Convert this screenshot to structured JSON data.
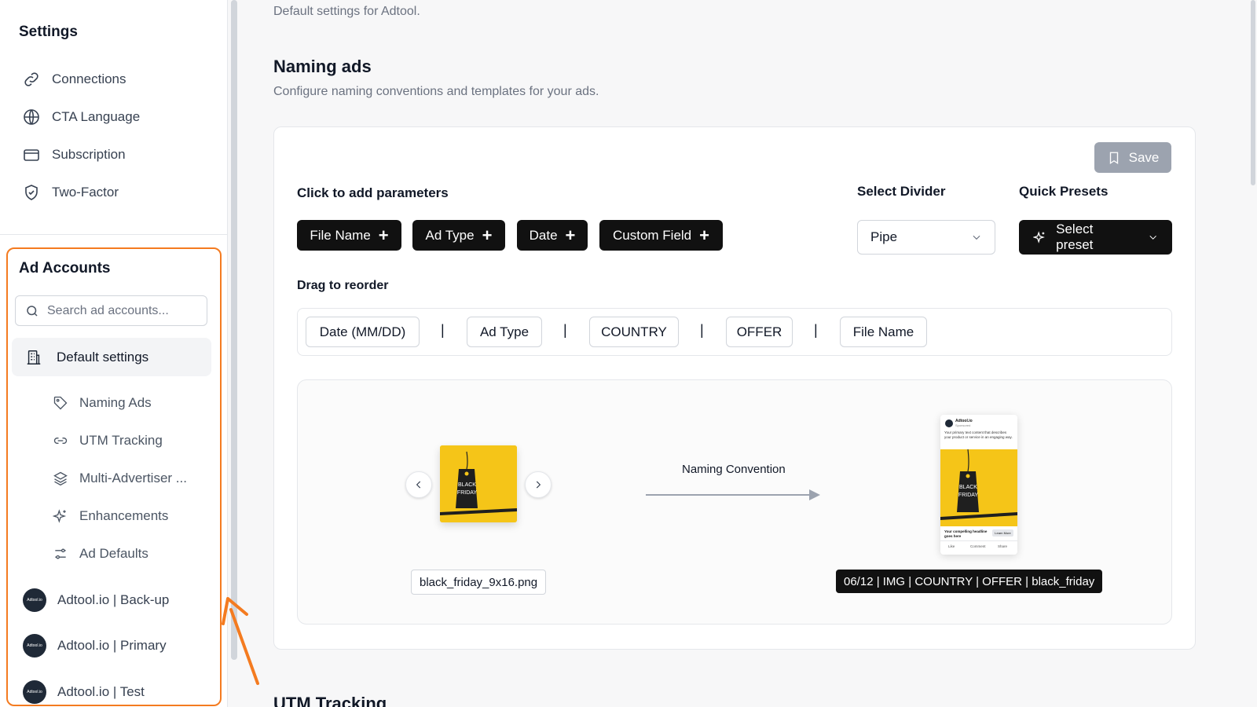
{
  "sidebar": {
    "title": "Settings",
    "nav": [
      {
        "label": "Connections",
        "icon": "link-icon"
      },
      {
        "label": "CTA Language",
        "icon": "globe-icon"
      },
      {
        "label": "Subscription",
        "icon": "credit-card-icon"
      },
      {
        "label": "Two-Factor",
        "icon": "shield-check-icon"
      }
    ],
    "ad_accounts": {
      "title": "Ad Accounts",
      "search_placeholder": "Search ad accounts...",
      "default_settings": "Default settings",
      "sub_items": [
        {
          "label": "Naming Ads",
          "icon": "tag-icon"
        },
        {
          "label": "UTM Tracking",
          "icon": "link-icon"
        },
        {
          "label": "Multi-Advertiser ...",
          "icon": "layers-icon"
        },
        {
          "label": "Enhancements",
          "icon": "sparkles-icon"
        },
        {
          "label": "Ad Defaults",
          "icon": "sliders-icon"
        }
      ],
      "accounts": [
        {
          "label": "Adtool.io | Back-up",
          "avatar": "Adtool.io"
        },
        {
          "label": "Adtool.io | Primary",
          "avatar": "Adtool.io"
        },
        {
          "label": "Adtool.io | Test",
          "avatar": "Adtool.io"
        }
      ],
      "highlight_color": "#f47b20"
    }
  },
  "main": {
    "subtitle": "Default settings for Adtool.",
    "title": "Naming ads",
    "description": "Configure naming conventions and templates for your ads.",
    "save_label": "Save",
    "params_label": "Click to add parameters",
    "params": [
      "File Name",
      "Ad Type",
      "Date",
      "Custom Field"
    ],
    "divider_label": "Select Divider",
    "divider_value": "Pipe",
    "presets_label": "Quick Presets",
    "presets_value": "Select preset",
    "reorder_label": "Drag to reorder",
    "reorder_chips": [
      "Date (MM/DD)",
      "Ad Type",
      "COUNTRY",
      "OFFER",
      "File Name"
    ],
    "divider_char": "|",
    "preview": {
      "thumb_text": [
        "BLACK",
        "FRIDAY"
      ],
      "file_name": "black_friday_9x16.png",
      "conversion_label": "Naming Convention",
      "result": "06/12 | IMG | COUNTRY | OFFER | black_friday",
      "phone_brand": "Adtool.io",
      "phone_sponsored": "Sponsored",
      "phone_body": "Your primary text content that describes your product or service in an engaging way.",
      "phone_headline": "Your compelling headline goes here",
      "phone_cta": "Learn More",
      "phone_actions": [
        "Like",
        "Comment",
        "Share"
      ]
    },
    "next_section": "UTM Tracking"
  }
}
